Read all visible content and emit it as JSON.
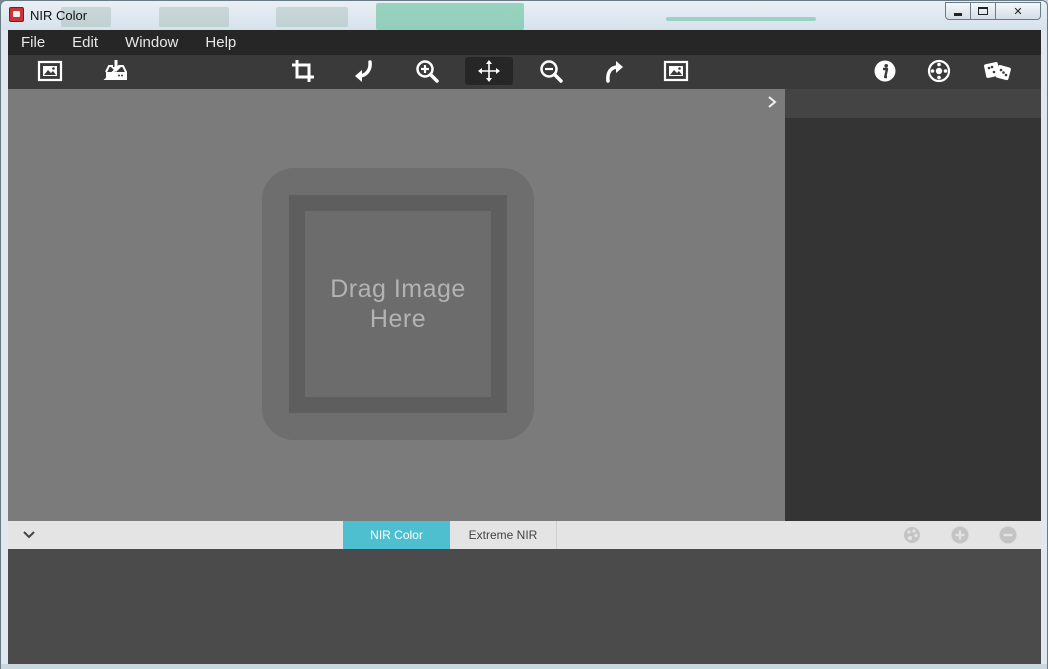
{
  "window": {
    "title": "NIR Color",
    "controls": {
      "minimize_icon": "minimize-icon",
      "maximize_icon": "maximize-icon",
      "close_label": "✕"
    }
  },
  "menu": {
    "items": [
      {
        "label": "File"
      },
      {
        "label": "Edit"
      },
      {
        "label": "Window"
      },
      {
        "label": "Help"
      }
    ]
  },
  "toolbar": {
    "buttons": [
      {
        "icon": "open-image-icon"
      },
      {
        "icon": "save-download-icon"
      },
      {
        "icon": "crop-icon"
      },
      {
        "icon": "rotate-left-icon"
      },
      {
        "icon": "zoom-in-icon"
      },
      {
        "icon": "move-pan-icon",
        "active": true
      },
      {
        "icon": "zoom-out-icon"
      },
      {
        "icon": "rotate-right-icon"
      },
      {
        "icon": "fit-image-icon"
      },
      {
        "icon": "info-icon"
      },
      {
        "icon": "settings-gear-icon"
      },
      {
        "icon": "random-dice-icon"
      }
    ]
  },
  "canvas": {
    "placeholder": "Drag Image Here",
    "panel_toggle_icon": "chevron-right-icon"
  },
  "bottom_bar": {
    "collapse_icon": "chevron-down-icon",
    "tabs": [
      {
        "label": "NIR Color",
        "active": true
      },
      {
        "label": "Extreme NIR",
        "active": false
      }
    ],
    "actions": [
      {
        "icon": "palette-icon"
      },
      {
        "icon": "add-icon"
      },
      {
        "icon": "remove-icon"
      }
    ]
  },
  "colors": {
    "accent_tab": "#4dbfcf",
    "menubar": "#262626",
    "toolbar": "#3a3a3a",
    "canvas": "#7b7b7b",
    "side_panel": "#343434",
    "presets_area": "#4b4b4b"
  }
}
